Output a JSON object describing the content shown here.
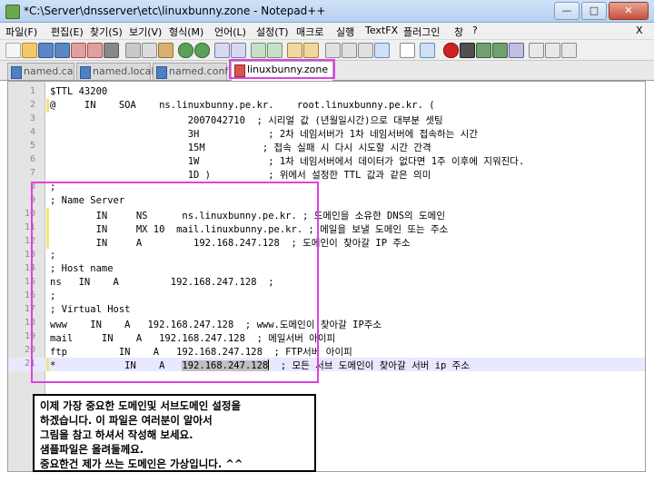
{
  "window": {
    "title": "*C:\\Server\\dnsserver\\etc\\linuxbunny.zone - Notepad++"
  },
  "menu": [
    "파일(F)",
    "편집(E)",
    "찾기(S)",
    "보기(V)",
    "형식(M)",
    "언어(L)",
    "설정(T)",
    "매크로",
    "실행",
    "TextFX",
    "플러그인",
    "창",
    "?"
  ],
  "menu_close": "X",
  "tabs": [
    {
      "label": "named.ca",
      "active": false,
      "modified": false
    },
    {
      "label": "named.local",
      "active": false,
      "modified": false
    },
    {
      "label": "named.conf",
      "active": false,
      "modified": false
    },
    {
      "label": "linuxbunny.zone",
      "active": true,
      "modified": true
    }
  ],
  "editor": {
    "lines": [
      {
        "num": "1",
        "text": "$TTL 43200"
      },
      {
        "num": "2",
        "text": "@     IN    SOA    ns.linuxbunny.pe.kr.    root.linuxbunny.pe.kr. ("
      },
      {
        "num": "3",
        "text": "                        2007042710  ; 시리얼 값 (년월일시간)으로 대부분 셋팅"
      },
      {
        "num": "4",
        "text": "                        3H            ; 2차 네임서버가 1차 네임서버에 접속하는 시간"
      },
      {
        "num": "5",
        "text": "                        15M          ; 접속 실패 시 다시 시도할 시간 간격"
      },
      {
        "num": "6",
        "text": "                        1W            ; 1차 네임서버에서 데이터가 없다면 1주 이후에 지워진다."
      },
      {
        "num": "7",
        "text": "                        1D )          ; 위에서 설정한 TTL 값과 같은 의미"
      },
      {
        "num": "8",
        "text": ";"
      },
      {
        "num": "9",
        "text": "; Name Server"
      },
      {
        "num": "10",
        "text": "        IN     NS      ns.linuxbunny.pe.kr. ; 도메인을 소유한 DNS의 도메인"
      },
      {
        "num": "11",
        "text": "        IN     MX 10  mail.linuxbunny.pe.kr. ; 메일을 보낼 도메인 또는 주소"
      },
      {
        "num": "12",
        "text": "        IN     A         192.168.247.128  ; 도메인이 찾아갈 IP 주소"
      },
      {
        "num": "13",
        "text": ";"
      },
      {
        "num": "14",
        "text": "; Host name"
      },
      {
        "num": "15",
        "text": "ns   IN    A         192.168.247.128  ;"
      },
      {
        "num": "16",
        "text": ";"
      },
      {
        "num": "17",
        "text": "; Virtual Host"
      },
      {
        "num": "18",
        "text": "www    IN    A   192.168.247.128  ; www.도메인이 찾아갈 IP주소"
      },
      {
        "num": "19",
        "text": "mail     IN    A   192.168.247.128  ; 메일서버 아이피"
      },
      {
        "num": "20",
        "text": "ftp         IN    A   192.168.247.128  ; FTP서버 아이피"
      },
      {
        "num": "21",
        "text": "*            IN    A   ",
        "selected": "192.168.247.128",
        "after": "  ; 모든 서브 도메인이 찾아갈 서버 ip 주소"
      }
    ]
  },
  "note": {
    "lines": [
      "이제 가장 중요한 도메인및 서브도메인 설정을",
      "하겠습니다. 이 파일은 여러분이 알아서",
      "그림을 참고 하셔서 작성해 보세요.",
      "샘플파일은 올려둘께요.",
      "중요한건 제가 쓰는 도메인은 가상입니다. ^^"
    ]
  }
}
